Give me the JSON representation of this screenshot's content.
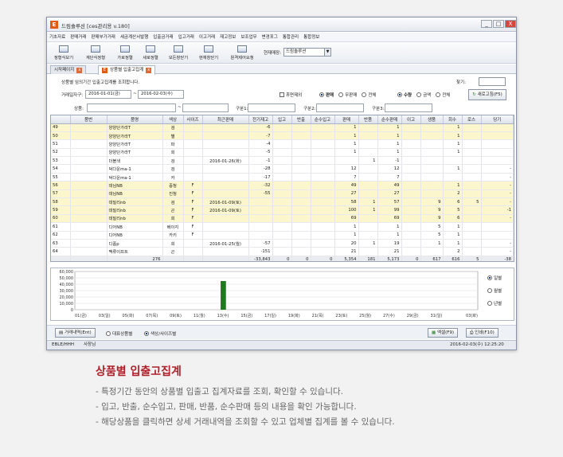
{
  "window": {
    "title": "드림솔루션 [ces관리용 v.180]",
    "min_label": "_",
    "max_label": "□",
    "close_label": "X"
  },
  "menu": [
    "기초자료",
    "판매거래",
    "판매부가거래",
    "세금계산서발행",
    "입출금거래",
    "입고거래",
    "이고거래",
    "재고정보",
    "보조업무",
    "변경포그",
    "통합관리",
    "통합정보"
  ],
  "toolbar": {
    "buttons": [
      "정형식보기",
      "계단식정형",
      "가로정렬",
      "세로정렬",
      "모든창닫기",
      "현재창닫기",
      "원격제어요청"
    ],
    "company_label": "현재매장:",
    "company_value": "드림솔루션"
  },
  "tabs": [
    {
      "label": "시작페이지"
    },
    {
      "label": "상품별 입출고집계"
    }
  ],
  "filters": {
    "description": "상품별 임의기간 입출고집계를 조회합니다.",
    "find_label": "찾기:",
    "period_label": "거래일자구:",
    "date_from": "2016-01-01(금)",
    "date_to": "2016-02-03(수)",
    "exclude_label": "휴면제외",
    "mode_options": [
      "판매",
      "무판매",
      "전체"
    ],
    "mode_selected": 0,
    "sort_options": [
      "수량",
      "금액",
      "전체"
    ],
    "sort_selected": 0,
    "refresh_label": "새로고침(F5)",
    "product_label": "상품:",
    "cat1_label": "구분1:",
    "cat2_label": "구분2:",
    "cat3_label": "구분3:",
    "tilde": "~"
  },
  "table": {
    "columns": [
      "",
      "품번",
      "품명",
      "색상",
      "사이즈",
      "최근판매",
      "전기재고",
      "입고",
      "반출",
      "순수입고",
      "판매",
      "반품",
      "순수판매",
      "이고",
      "생품",
      "회수",
      "로스",
      "당기"
    ],
    "rows": [
      {
        "no": "49",
        "code": "",
        "name": "양양단가라T",
        "color": "검",
        "size": "",
        "recent": "",
        "prev": "-6",
        "in": "",
        "out": "",
        "netin": "",
        "sale": "1",
        "ret": "",
        "netsale": "1",
        "move": "",
        "gen": "",
        "back": "1",
        "loss": "",
        "cur": "",
        "hl": true
      },
      {
        "no": "50",
        "code": "",
        "name": "양양단가라T",
        "color": "별",
        "size": "",
        "recent": "",
        "prev": "-7",
        "in": "",
        "out": "",
        "netin": "",
        "sale": "1",
        "ret": "",
        "netsale": "1",
        "move": "",
        "gen": "",
        "back": "1",
        "loss": "",
        "cur": "",
        "hl": true
      },
      {
        "no": "51",
        "code": "",
        "name": "양양단가라T",
        "color": "파",
        "size": "",
        "recent": "",
        "prev": "-4",
        "in": "",
        "out": "",
        "netin": "",
        "sale": "1",
        "ret": "",
        "netsale": "1",
        "move": "",
        "gen": "",
        "back": "1",
        "loss": "",
        "cur": "",
        "hl": false
      },
      {
        "no": "52",
        "code": "",
        "name": "양양단가라T",
        "color": "회",
        "size": "",
        "recent": "",
        "prev": "-5",
        "in": "",
        "out": "",
        "netin": "",
        "sale": "1",
        "ret": "",
        "netsale": "1",
        "move": "",
        "gen": "",
        "back": "1",
        "loss": "",
        "cur": "",
        "hl": false
      },
      {
        "no": "53",
        "code": "",
        "name": "더블색",
        "color": "검",
        "size": "",
        "recent": "2016-01-26(화)",
        "prev": "-1",
        "in": "",
        "out": "",
        "netin": "",
        "sale": "",
        "ret": "1",
        "netsale": "-1",
        "move": "",
        "gen": "",
        "back": "",
        "loss": "",
        "cur": "",
        "hl": false
      },
      {
        "no": "54",
        "code": "",
        "name": "덕다운ma-1",
        "color": "검",
        "size": "",
        "recent": "",
        "prev": "-28",
        "in": "",
        "out": "",
        "netin": "",
        "sale": "12",
        "ret": "",
        "netsale": "12",
        "move": "",
        "gen": "",
        "back": "1",
        "loss": "",
        "cur": "-",
        "hl": false
      },
      {
        "no": "55",
        "code": "",
        "name": "덕다운ma-1",
        "color": "카",
        "size": "",
        "recent": "",
        "prev": "-17",
        "in": "",
        "out": "",
        "netin": "",
        "sale": "7",
        "ret": "",
        "netsale": "7",
        "move": "",
        "gen": "",
        "back": "",
        "loss": "",
        "cur": "-",
        "hl": false
      },
      {
        "no": "56",
        "code": "",
        "name": "데님NB",
        "color": "중청",
        "size": "F",
        "recent": "",
        "prev": "-32",
        "in": "",
        "out": "",
        "netin": "",
        "sale": "49",
        "ret": "",
        "netsale": "49",
        "move": "",
        "gen": "",
        "back": "1",
        "loss": "",
        "cur": "-",
        "hl": true
      },
      {
        "no": "57",
        "code": "",
        "name": "데님NB",
        "color": "진청",
        "size": "F",
        "recent": "",
        "prev": "-55",
        "in": "",
        "out": "",
        "netin": "",
        "sale": "27",
        "ret": "",
        "netsale": "27",
        "move": "",
        "gen": "",
        "back": "2",
        "loss": "",
        "cur": "-",
        "hl": true
      },
      {
        "no": "58",
        "code": "",
        "name": "데밀리nb",
        "color": "검",
        "size": "F",
        "recent": "2016-01-09(토)",
        "prev": "",
        "in": "",
        "out": "",
        "netin": "",
        "sale": "58",
        "ret": "1",
        "netsale": "57",
        "move": "",
        "gen": "9",
        "back": "6",
        "loss": "5",
        "cur": "-",
        "hl": true
      },
      {
        "no": "59",
        "code": "",
        "name": "데밀리nb",
        "color": "곤",
        "size": "F",
        "recent": "2016-01-09(토)",
        "prev": "",
        "in": "",
        "out": "",
        "netin": "",
        "sale": "100",
        "ret": "1",
        "netsale": "99",
        "move": "",
        "gen": "9",
        "back": "5",
        "loss": "",
        "cur": "-1",
        "hl": true
      },
      {
        "no": "60",
        "code": "",
        "name": "데밀리nb",
        "color": "회",
        "size": "F",
        "recent": "",
        "prev": "",
        "in": "",
        "out": "",
        "netin": "",
        "sale": "69",
        "ret": "",
        "netsale": "69",
        "move": "",
        "gen": "9",
        "back": "6",
        "loss": "",
        "cur": "-",
        "hl": true
      },
      {
        "no": "61",
        "code": "",
        "name": "디어NB",
        "color": "베이지",
        "size": "F",
        "recent": "",
        "prev": "",
        "in": "",
        "out": "",
        "netin": "",
        "sale": "1",
        "ret": "",
        "netsale": "1",
        "move": "",
        "gen": "5",
        "back": "1",
        "loss": "",
        "cur": "",
        "hl": false
      },
      {
        "no": "62",
        "code": "",
        "name": "디어NB",
        "color": "카키",
        "size": "F",
        "recent": "",
        "prev": "",
        "in": "",
        "out": "",
        "netin": "",
        "sale": "1",
        "ret": "",
        "netsale": "1",
        "move": "",
        "gen": "5",
        "back": "1",
        "loss": "",
        "cur": "",
        "hl": false
      },
      {
        "no": "63",
        "code": "",
        "name": "디폼p",
        "color": "회",
        "size": "",
        "recent": "2016-01-25(월)",
        "prev": "-57",
        "in": "",
        "out": "",
        "netin": "",
        "sale": "20",
        "ret": "1",
        "netsale": "19",
        "move": "",
        "gen": "1",
        "back": "1",
        "loss": "",
        "cur": "-",
        "hl": false
      },
      {
        "no": "64",
        "code": "",
        "name": "맥류이프트",
        "color": "곤",
        "size": "",
        "recent": "",
        "prev": "-151",
        "in": "",
        "out": "",
        "netin": "",
        "sale": "21",
        "ret": "",
        "netsale": "21",
        "move": "",
        "gen": "",
        "back": "2",
        "loss": "",
        "cur": "-",
        "hl": false
      }
    ],
    "totals": {
      "no": "",
      "code": "",
      "name": "276",
      "color": "",
      "size": "",
      "recent": "",
      "prev": "-33,843",
      "in": "0",
      "out": "0",
      "netin": "0",
      "sale": "5,354",
      "ret": "181",
      "netsale": "5,173",
      "move": "0",
      "gen": "617",
      "back": "616",
      "loss": "5",
      "cur": "-38"
    }
  },
  "chart_data": {
    "type": "bar",
    "categories": [
      "01(금)",
      "03(일)",
      "05(화)",
      "07(목)",
      "09(토)",
      "11(월)",
      "13(수)",
      "15(금)",
      "17(일)",
      "19(화)",
      "21(목)",
      "23(토)",
      "25(월)",
      "27(수)",
      "29(금)",
      "31(일)",
      "03(화)"
    ],
    "x": [
      "01(금)",
      "02",
      "03(일)",
      "04",
      "05(화)",
      "06",
      "07(목)",
      "08",
      "09(토)",
      "10",
      "11(월)",
      "12",
      "13(수)",
      "14",
      "15(금)",
      "16",
      "17(일)",
      "18",
      "19(화)",
      "20",
      "21(목)",
      "22",
      "23(토)",
      "24",
      "25(월)",
      "26",
      "27(수)",
      "28",
      "29(금)",
      "30",
      "31(일)",
      "01",
      "02",
      "03(화)"
    ],
    "values": [
      0,
      0,
      0,
      0,
      0,
      0,
      0,
      0,
      0,
      0,
      0,
      0,
      45000,
      0,
      0,
      0,
      0,
      0,
      0,
      0,
      0,
      0,
      0,
      0,
      0,
      0,
      0,
      0,
      0,
      0,
      0,
      0,
      0,
      0
    ],
    "yticks": [
      "60,000",
      "50,000",
      "40,000",
      "30,000",
      "20,000",
      "10,000",
      "0"
    ],
    "ylim": [
      0,
      60000
    ],
    "options": [
      "일별",
      "월별",
      "년별"
    ],
    "selected": 0
  },
  "bottom": {
    "detail_button": "거래내역(Ent)",
    "view_options": [
      "대표상품별",
      "색상/사이즈별"
    ],
    "view_selected": 1,
    "excel_button": "엑셀(F9)",
    "print_button": "인쇄(F10)"
  },
  "status": {
    "left": "EBLE/HHH",
    "user": "사장님",
    "time": "2016-02-03(수) 12:25:20"
  },
  "caption": {
    "title": "상품별 입출고집계",
    "bullets": [
      "- 특정기간 동안의 상품별 입출고 집계자료를 조회, 확인할 수 있습니다.",
      "- 입고, 반출, 순수입고, 판매, 반품, 순수판매 등의 내용을 확인 가능합니다.",
      "- 해당상품을 클릭하면 상세 거래내역을 조회할 수 있고 업체별 집계를 볼 수 있습니다."
    ]
  },
  "colors": {
    "accent": "#b0202a",
    "highlight_row": "#fbf6cc",
    "bar": "#1f7a1f"
  }
}
